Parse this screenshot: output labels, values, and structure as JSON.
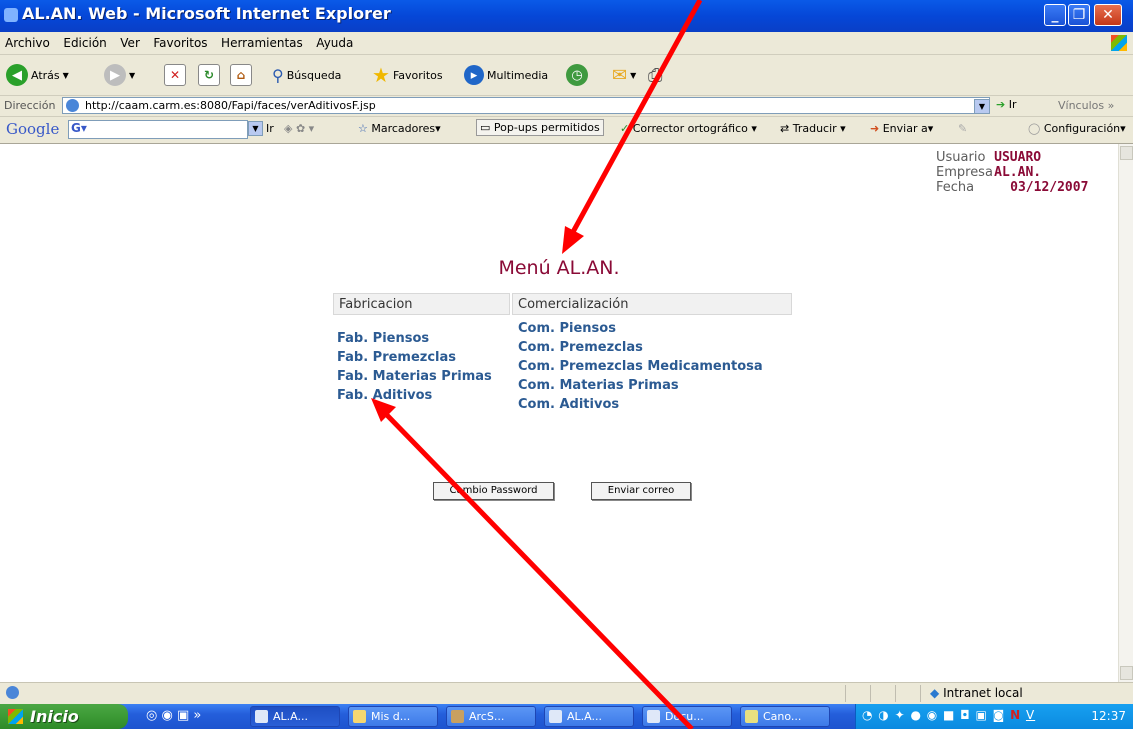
{
  "window": {
    "title": "AL.AN. Web - Microsoft Internet Explorer"
  },
  "menubar": [
    "Archivo",
    "Edición",
    "Ver",
    "Favoritos",
    "Herramientas",
    "Ayuda"
  ],
  "toolbar": {
    "back": "Atrás",
    "search": "Búsqueda",
    "favorites": "Favoritos",
    "multimedia": "Multimedia"
  },
  "address": {
    "label": "Dirección",
    "url": "http://caam.carm.es:8080/Fapi/faces/verAditivosF.jsp",
    "go": "Ir",
    "links": "Vínculos"
  },
  "google": {
    "logo": "Google",
    "go": "Ir",
    "bookmarks": "Marcadores",
    "popups": "Pop-ups permitidos",
    "spell": "Corrector ortográfico",
    "translate": "Traducir",
    "send": "Enviar a",
    "settings": "Configuración"
  },
  "info": {
    "user_label": "Usuario",
    "user_value": "USUARO",
    "company_label": "Empresa",
    "company_value": "AL.AN.",
    "date_label": "Fecha",
    "date_value": "03/12/2007"
  },
  "menu": {
    "title": "Menú AL.AN.",
    "col1": {
      "header": "Fabricacion",
      "items": [
        "Fab. Piensos",
        "Fab. Premezclas",
        "Fab. Materias Primas",
        "Fab. Aditivos"
      ]
    },
    "col2": {
      "header": "Comercialización",
      "items": [
        "Com. Piensos",
        "Com. Premezclas",
        "Com. Premezclas Medicamentosa",
        "Com. Materias Primas",
        "Com. Aditivos"
      ]
    }
  },
  "buttons": {
    "password": "Cambio Password",
    "mail": "Enviar correo"
  },
  "statusbar": {
    "zone": "Intranet local"
  },
  "taskbar": {
    "start": "Inicio",
    "tasks": [
      "AL.A...",
      "Mis d...",
      "ArcS...",
      "AL.A...",
      "Docu...",
      "Cano..."
    ],
    "clock": "12:37"
  },
  "colors": {
    "accent": "#8a0a36",
    "link": "#2b5a92",
    "annotation": "#ff0000"
  }
}
